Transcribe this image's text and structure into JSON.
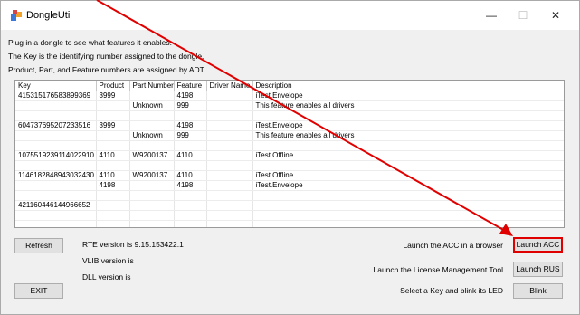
{
  "window": {
    "title": "DongleUtil",
    "controls": {
      "minimize": "—",
      "maximize": "☐",
      "close": "✕"
    }
  },
  "intro": [
    "Plug in a dongle to see what features it enables.",
    "The Key is the identifying number assigned to the dongle.",
    "Product, Part, and Feature numbers are assigned by ADT."
  ],
  "table": {
    "columns": [
      "Key",
      "Product",
      "Part Number",
      "Feature",
      "Driver Name",
      "Description"
    ],
    "rows": [
      [
        "415315176583899369",
        "3999",
        "",
        "4198",
        "",
        "iTest.Envelope"
      ],
      [
        "",
        "",
        "Unknown",
        "999",
        "",
        "This feature enables all drivers"
      ],
      [
        "",
        "",
        "",
        "",
        "",
        ""
      ],
      [
        "604737695207233516",
        "3999",
        "",
        "4198",
        "",
        "iTest.Envelope"
      ],
      [
        "",
        "",
        "Unknown",
        "999",
        "",
        "This feature enables all drivers"
      ],
      [
        "",
        "",
        "",
        "",
        "",
        ""
      ],
      [
        "1075519239114022910",
        "4110",
        "W9200137",
        "4110",
        "",
        "iTest.Offline"
      ],
      [
        "",
        "",
        "",
        "",
        "",
        ""
      ],
      [
        "1146182848943032430",
        "4110",
        "W9200137",
        "4110",
        "",
        "iTest.Offline"
      ],
      [
        "",
        "4198",
        "",
        "4198",
        "",
        "iTest.Envelope"
      ],
      [
        "",
        "",
        "",
        "",
        "",
        ""
      ],
      [
        "421160446144966652",
        "",
        "",
        "",
        "",
        ""
      ],
      [
        "",
        "",
        "",
        "",
        "",
        ""
      ],
      [
        "",
        "",
        "",
        "",
        "",
        ""
      ]
    ]
  },
  "buttons": {
    "refresh": "Refresh",
    "exit": "EXIT",
    "launch_acc": "Launch ACC",
    "launch_rus": "Launch RUS",
    "blink": "Blink"
  },
  "versions": {
    "rte": "RTE  version is 9.15.153422.1",
    "vlib": "VLIB version is",
    "dll": "DLL  version is"
  },
  "actions": {
    "acc_label": "Launch the ACC in a browser",
    "rus_label": "Launch the License Management Tool",
    "blink_label": "Select a Key and blink its LED"
  },
  "annotation": {
    "arrow_color": "#e00000"
  }
}
